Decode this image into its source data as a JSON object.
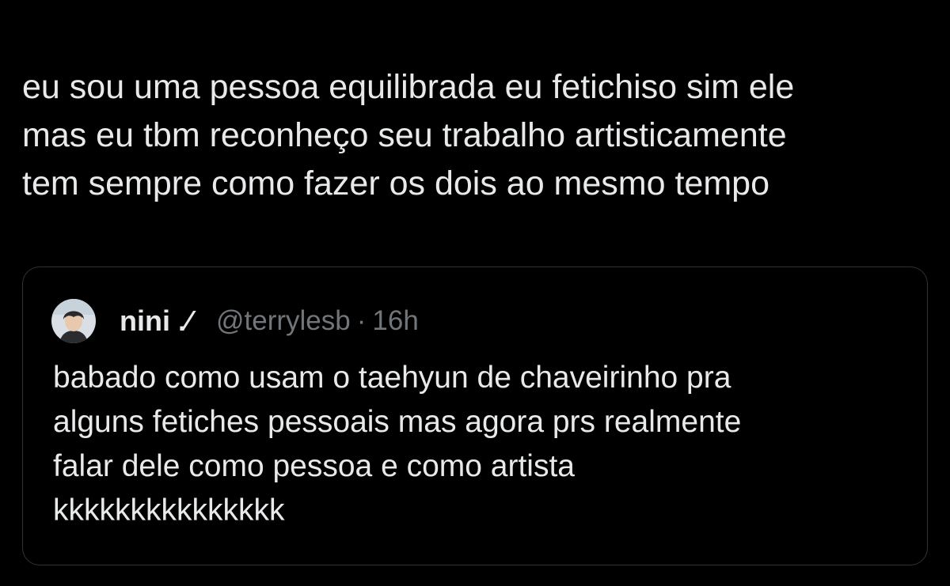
{
  "tweet": {
    "text_lines": [
      "eu sou uma pessoa equilibrada eu fetichiso sim ele",
      "mas eu tbm reconheço seu trabalho artisticamente",
      "tem sempre como fazer os dois ao mesmo tempo"
    ]
  },
  "quote": {
    "avatar_icon": "avatar-photo",
    "display_name": "nini .⁄",
    "handle": "@terrylesb",
    "separator": "·",
    "time": "16h",
    "text_lines": [
      "babado como usam o taehyun de chaveirinho pra",
      "alguns fetiches pessoais mas agora prs realmente",
      "falar dele como pessoa e como artista",
      "kkkkkkkkkkkkkkk"
    ]
  },
  "colors": {
    "background": "#000000",
    "text_primary": "#e7e9ea",
    "text_secondary": "#71767b",
    "border": "#2f3336"
  }
}
